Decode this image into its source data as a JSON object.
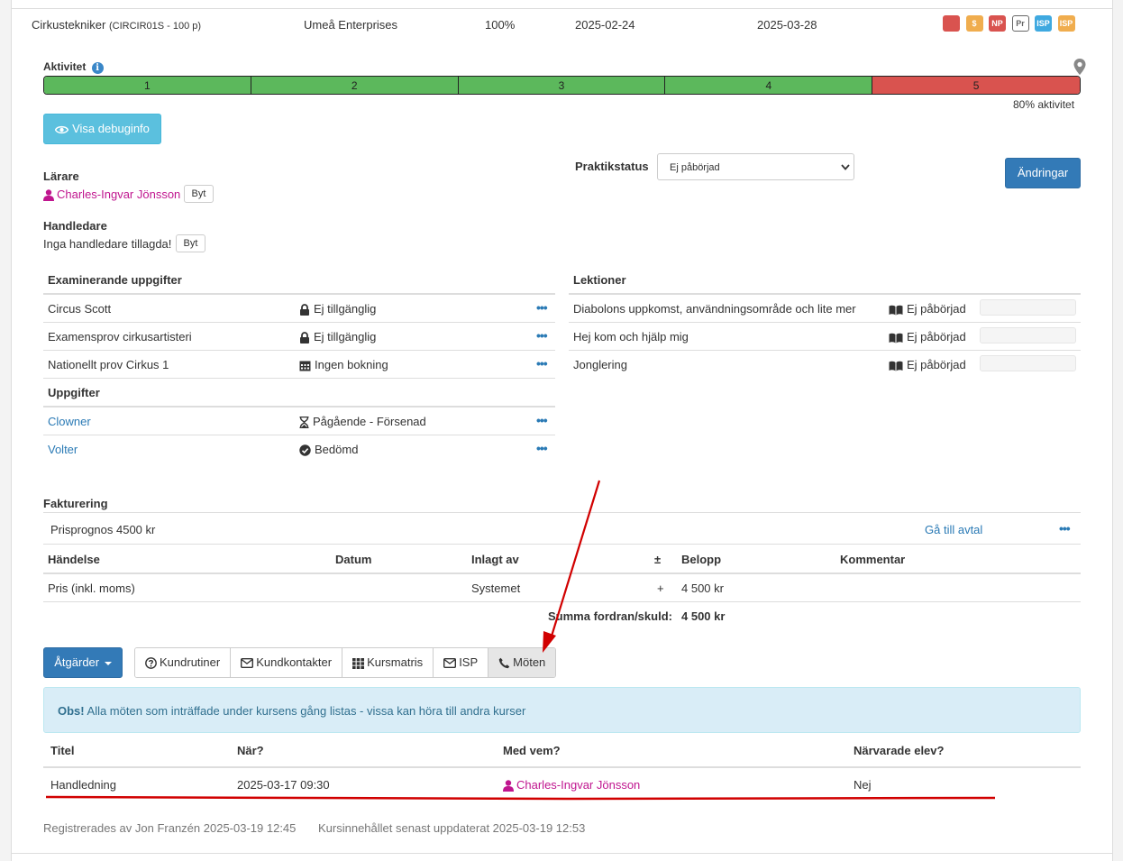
{
  "course": {
    "name": "Cirkustekniker",
    "code": "(CIRCIR01S - 100 p)",
    "provider": "Umeå Enterprises",
    "pace": "100%",
    "start": "2025-02-24",
    "end": "2025-03-28",
    "badges": [
      {
        "label": "",
        "color": "#d9534f",
        "style": "solid"
      },
      {
        "label": "$",
        "color": "#f0ad4e",
        "style": "solid"
      },
      {
        "label": "NP",
        "color": "#d9534f",
        "style": "solid"
      },
      {
        "label": "Pr",
        "color": "#666666",
        "style": "outline"
      },
      {
        "label": "ISP",
        "color": "#3fa9e0",
        "style": "solid"
      },
      {
        "label": "ISP",
        "color": "#f0ad4e",
        "style": "solid"
      }
    ]
  },
  "activity": {
    "label": "Aktivitet",
    "segments": [
      {
        "label": "1",
        "color": "#5cb85c"
      },
      {
        "label": "2",
        "color": "#5cb85c"
      },
      {
        "label": "3",
        "color": "#5cb85c"
      },
      {
        "label": "4",
        "color": "#5cb85c"
      },
      {
        "label": "5",
        "color": "#d9534f"
      }
    ],
    "percent_text": "80% aktivitet",
    "progress": 0.8
  },
  "debug_button": "Visa debuginfo",
  "teacher": {
    "heading": "Lärare",
    "name": "Charles-Ingvar Jönsson",
    "swap": "Byt"
  },
  "supervisor": {
    "heading": "Handledare",
    "text": "Inga handledare tillagda!",
    "swap": "Byt"
  },
  "practice": {
    "label": "Praktikstatus",
    "value": "Ej påbörjad"
  },
  "changes_button": "Ändringar",
  "exam_tasks": {
    "heading": "Examinerande uppgifter",
    "rows": [
      {
        "name": "Circus Scott",
        "status": "Ej tillgänglig",
        "icon": "lock-icon"
      },
      {
        "name": "Examensprov cirkusartisteri",
        "status": "Ej tillgänglig",
        "icon": "lock-icon"
      },
      {
        "name": "Nationellt prov Cirkus 1",
        "status": "Ingen bokning",
        "icon": "calendar-icon"
      }
    ]
  },
  "tasks": {
    "heading": "Uppgifter",
    "rows": [
      {
        "name": "Clowner",
        "status": "Pågående - Försenad",
        "icon": "hourglass-icon"
      },
      {
        "name": "Volter",
        "status": "Bedömd",
        "icon": "check-circle-icon"
      }
    ]
  },
  "lessons": {
    "heading": "Lektioner",
    "rows": [
      {
        "name": "Diabolons uppkomst, användningsområde och lite mer",
        "status": "Ej påbörjad"
      },
      {
        "name": "Hej kom och hjälp mig",
        "status": "Ej påbörjad"
      },
      {
        "name": "Jonglering",
        "status": "Ej påbörjad"
      }
    ]
  },
  "billing": {
    "heading": "Fakturering",
    "forecast": "Prisprognos 4500 kr",
    "agreement_link": "Gå till avtal",
    "columns": [
      "Händelse",
      "Datum",
      "Inlagt av",
      "±",
      "Belopp",
      "Kommentar"
    ],
    "rows": [
      {
        "event": "Pris (inkl. moms)",
        "date": "",
        "by": "Systemet",
        "sign": "+",
        "amount": "4 500 kr",
        "comment": ""
      }
    ],
    "sum_label": "Summa fordran/skuld:",
    "sum_value": "4 500 kr"
  },
  "actions_button": "Åtgärder",
  "tabs": [
    "Kundrutiner",
    "Kundkontakter",
    "Kursmatris",
    "ISP",
    "Möten"
  ],
  "notice": {
    "strong": "Obs!",
    "text": " Alla möten som inträffade under kursens gång listas - vissa kan höra till andra kurser"
  },
  "meetings": {
    "columns": [
      "Titel",
      "När?",
      "Med vem?",
      "Närvarade elev?"
    ],
    "rows": [
      {
        "title": "Handledning",
        "when": "2025-03-17 09:30",
        "with": "Charles-Ingvar Jönsson",
        "attended": "Nej"
      }
    ]
  },
  "footer": {
    "registered": "Registrerades av Jon Franzén 2025-03-19 12:45",
    "updated": "Kursinnehållet senast uppdaterat 2025-03-19 12:53"
  }
}
